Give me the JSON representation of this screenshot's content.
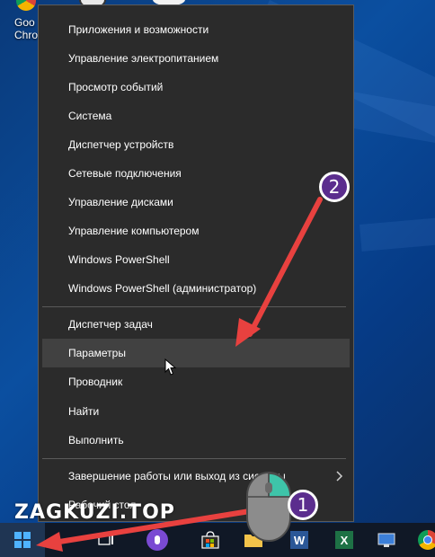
{
  "desktop": {
    "icon_label_line1": "Goo",
    "icon_label_line2": "Chro"
  },
  "menu": {
    "items": [
      {
        "label": "Приложения и возможности"
      },
      {
        "label": "Управление электропитанием"
      },
      {
        "label": "Просмотр событий"
      },
      {
        "label": "Система"
      },
      {
        "label": "Диспетчер устройств"
      },
      {
        "label": "Сетевые подключения"
      },
      {
        "label": "Управление дисками"
      },
      {
        "label": "Управление компьютером"
      },
      {
        "label": "Windows PowerShell"
      },
      {
        "label": "Windows PowerShell (администратор)"
      },
      {
        "label": "Диспетчер задач"
      },
      {
        "label": "Параметры"
      },
      {
        "label": "Проводник"
      },
      {
        "label": "Найти"
      },
      {
        "label": "Выполнить"
      },
      {
        "label": "Завершение работы или выход из системы"
      },
      {
        "label": "Рабочий стол"
      }
    ],
    "hovered_item": "Параметры"
  },
  "annotations": {
    "badge_1": "1",
    "badge_2": "2",
    "arrow_color": "#e8413f",
    "badge_color": "#5b2d8e"
  },
  "watermark": "ZAGKUZI.TOP",
  "taskbar": {
    "icons": [
      "windows-start-icon",
      "task-view-icon",
      "cortana-mic-icon",
      "store-icon",
      "file-explorer-icon",
      "word-icon",
      "excel-icon",
      "network-icon",
      "chrome-icon"
    ]
  },
  "colors": {
    "menu_bg": "#2b2b2b",
    "menu_hover": "#414141",
    "taskbar_bg": "#101826"
  }
}
